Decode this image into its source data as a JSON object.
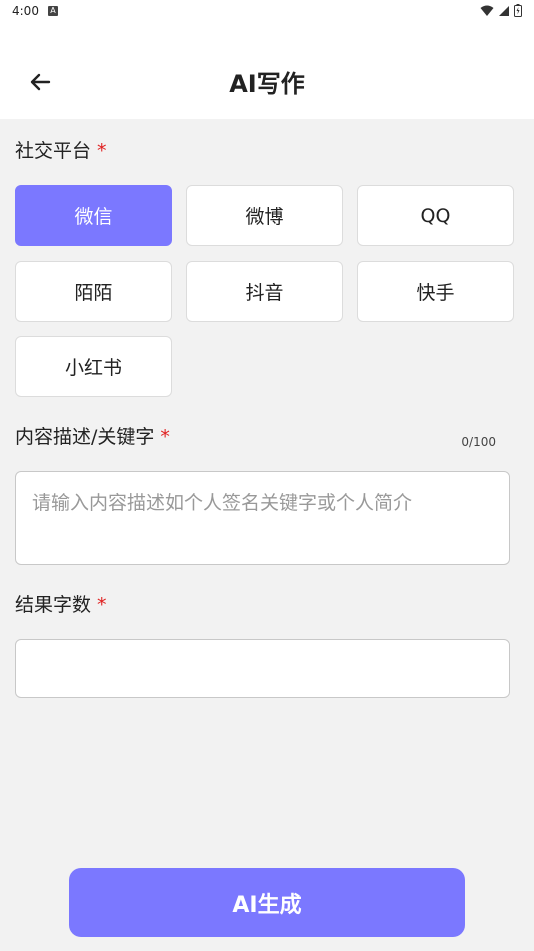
{
  "status_bar": {
    "time": "4:00",
    "icons": [
      "a-notification-icon",
      "wifi-icon",
      "signal-icon",
      "battery-icon"
    ]
  },
  "header": {
    "title": "AI写作",
    "back_icon": "arrow-left-icon"
  },
  "platform_section": {
    "label": "社交平台",
    "required_mark": "*",
    "options": [
      {
        "label": "微信",
        "selected": true
      },
      {
        "label": "微博",
        "selected": false
      },
      {
        "label": "QQ",
        "selected": false
      },
      {
        "label": "陌陌",
        "selected": false
      },
      {
        "label": "抖音",
        "selected": false
      },
      {
        "label": "快手",
        "selected": false
      },
      {
        "label": "小红书",
        "selected": false
      }
    ]
  },
  "description_section": {
    "label": "内容描述/关键字",
    "required_mark": "*",
    "counter": "0/100",
    "value": "",
    "placeholder": "请输入内容描述如个人签名关键字或个人简介"
  },
  "word_count_section": {
    "label": "结果字数",
    "required_mark": "*",
    "value": "",
    "placeholder": ""
  },
  "actions": {
    "generate_label": "AI生成"
  },
  "colors": {
    "accent": "#7b78ff",
    "required": "#e02020",
    "background": "#f2f2f2"
  }
}
